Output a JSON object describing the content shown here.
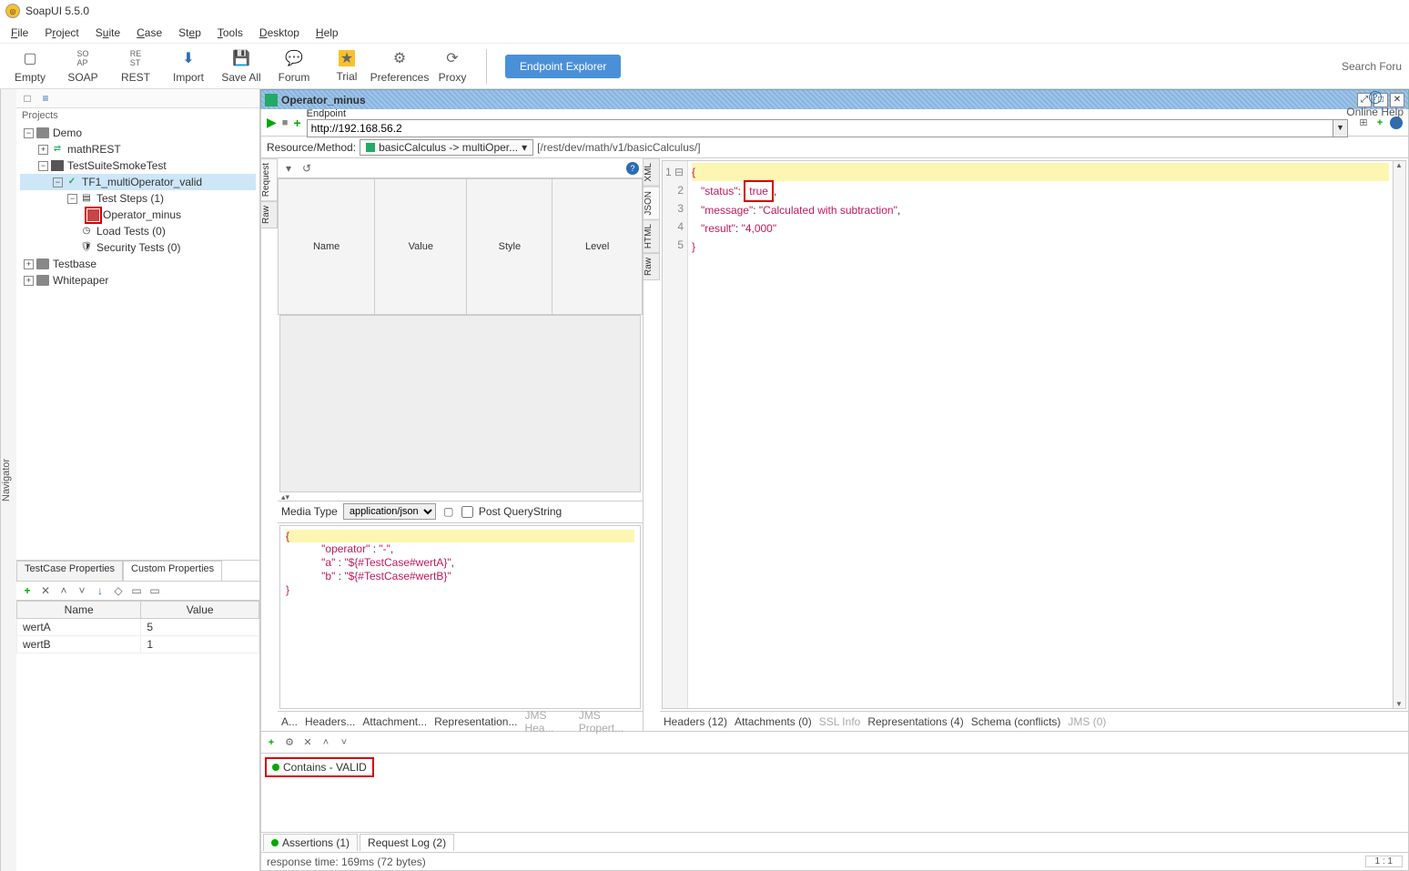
{
  "app": {
    "title": "SoapUI 5.5.0"
  },
  "menu": [
    "File",
    "Project",
    "Suite",
    "Case",
    "Step",
    "Tools",
    "Desktop",
    "Help"
  ],
  "toolbar": {
    "buttons": [
      "Empty",
      "SOAP",
      "REST",
      "Import",
      "Save All",
      "Forum",
      "Trial",
      "Preferences",
      "Proxy"
    ],
    "endpoint_explorer": "Endpoint Explorer",
    "search": "Search Foru"
  },
  "navigator_label": "Navigator",
  "projects_label": "Projects",
  "tree": {
    "demo": "Demo",
    "mathRest": "mathREST",
    "testSuite": "TestSuiteSmokeTest",
    "tf1": "TF1_multiOperator_valid",
    "testSteps": "Test Steps (1)",
    "operatorMinus": "Operator_minus",
    "loadTests": "Load Tests (0)",
    "securityTests": "Security Tests (0)",
    "testbase": "Testbase",
    "whitepaper": "Whitepaper"
  },
  "props": {
    "tab1": "TestCase Properties",
    "tab2": "Custom Properties",
    "cols": [
      "Name",
      "Value"
    ],
    "rows": [
      {
        "name": "wertA",
        "value": "5"
      },
      {
        "name": "wertB",
        "value": "1"
      }
    ]
  },
  "doc": {
    "title": "Operator_minus",
    "endpoint_label": "Endpoint",
    "endpoint": "http://192.168.56.2",
    "resource_label": "Resource/Method:",
    "resource_btn": "basicCalculus -> multiOper...",
    "resource_path": "[/rest/dev/math/v1/basicCalculus/]"
  },
  "param_cols": [
    "Name",
    "Value",
    "Style",
    "Level"
  ],
  "media": {
    "label": "Media Type",
    "value": "application/json",
    "post_qs": "Post QueryString"
  },
  "request_body": {
    "l1": "{",
    "l2_key": "\"operator\"",
    "l2_sep": " : ",
    "l2_val": "\"-\"",
    "l2_end": ",",
    "l3_key": "\"a\"",
    "l3_sep": " : ",
    "l3_val": "\"${#TestCase#wertA}\"",
    "l3_end": ",",
    "l4_key": "\"b\"",
    "l4_sep": " : ",
    "l4_val": "\"${#TestCase#wertB}\"",
    "l5": "}"
  },
  "req_tabs": {
    "a": "A...",
    "h": "Headers...",
    "att": "Attachment...",
    "rep": "Representation...",
    "jh": "JMS Hea...",
    "jp": "JMS Propert..."
  },
  "resp_side_tabs": [
    "XML",
    "JSON",
    "HTML",
    "Raw"
  ],
  "req_side_tabs": [
    "Request",
    "Raw"
  ],
  "response": {
    "l1": "{",
    "l2_key": "\"status\"",
    "l2_sep": ": ",
    "l2_val": "true",
    "l2_end": ",",
    "l3_key": "\"message\"",
    "l3_sep": ": ",
    "l3_val": "\"Calculated with subtraction\"",
    "l3_end": ",",
    "l4_key": "\"result\"",
    "l4_sep": ": ",
    "l4_val": "\"4,000\"",
    "l5": "}"
  },
  "resp_tabs": {
    "h": "Headers (12)",
    "a": "Attachments (0)",
    "s": "SSL Info",
    "r": "Representations (4)",
    "sc": "Schema (conflicts)",
    "j": "JMS (0)"
  },
  "assertions": {
    "item": "Contains - VALID",
    "help": "Online Help",
    "tab1": "Assertions (1)",
    "tab2": "Request Log (2)"
  },
  "status": {
    "text": "response time: 169ms (72 bytes)",
    "pos": "1 : 1"
  }
}
